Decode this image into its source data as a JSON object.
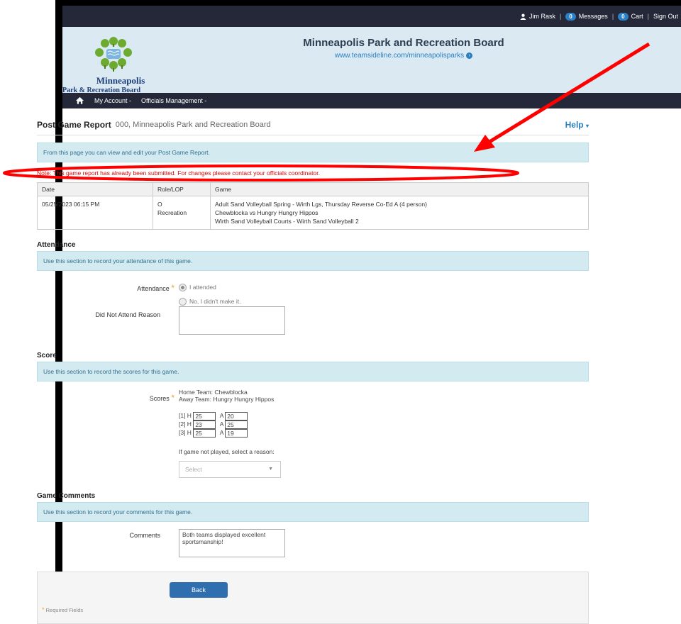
{
  "topbar": {
    "user": "Jim Rask",
    "messages_count": "0",
    "messages_label": "Messages",
    "cart_count": "0",
    "cart_label": "Cart",
    "signout_label": "Sign Out"
  },
  "header": {
    "logo_line1": "Minneapolis",
    "logo_line2": "Park & Recreation Board",
    "title": "Minneapolis Park and Recreation Board",
    "url": "www.teamsideline.com/minneapolisparks"
  },
  "nav": {
    "items": [
      "My Account -",
      "Officials Management -"
    ]
  },
  "page": {
    "title": "Post Game Report",
    "subtitle": "000, Minneapolis Park and Recreation Board",
    "help": "Help"
  },
  "intro": "From this page you can view and edit your Post Game Report.",
  "note": "Note: This game report has already been submitted. For changes please contact your officials coordinator.",
  "game_table": {
    "headers": [
      "Date",
      "Role/LOP",
      "Game"
    ],
    "date": "05/25/2023 06:15 PM",
    "role_line1": "O",
    "role_line2": "Recreation",
    "game_line1": "Adult Sand Volleyball Spring - Wirth Lgs, Thursday Reverse Co-Ed A (4 person)",
    "game_line2": "Chewblocka vs Hungry Hungry Hippos",
    "game_line3": "Wirth Sand Volleyball Courts - Wirth Sand Volleyball 2"
  },
  "attendance": {
    "section_title": "Attendance",
    "info": "Use this section to record your attendance of this game.",
    "label": "Attendance",
    "option_yes": "I attended",
    "option_no": "No, I didn't make it.",
    "reason_label": "Did Not Attend Reason"
  },
  "score": {
    "section_title": "Score",
    "info": "Use this section to record the scores for this game.",
    "label": "Scores",
    "home_team": "Home Team: Chewblocka",
    "away_team": "Away Team: Hungry Hungry Hippos",
    "sets": [
      {
        "set": "[1] H",
        "home": "25",
        "away": "20"
      },
      {
        "set": "[2] H",
        "home": "23",
        "away": "25"
      },
      {
        "set": "[3] H",
        "home": "25",
        "away": "19"
      }
    ],
    "away_prefix": "A",
    "not_played_label": "If game not played, select a reason:",
    "select_placeholder": "Select"
  },
  "comments": {
    "section_title": "Game Comments",
    "info": "Use this section to record your comments for this game.",
    "label": "Comments",
    "value": "Both teams displayed excellent sportsmanship!"
  },
  "footer": {
    "back_label": "Back",
    "required_label": "Required Fields"
  },
  "colors": {
    "navbar": "#252838",
    "header_bg": "#dbe9f3",
    "info_bg": "#d3eaf0",
    "note_red": "#e00000",
    "button_blue": "#2f6fb0",
    "annotation_red": "#ff0000"
  }
}
